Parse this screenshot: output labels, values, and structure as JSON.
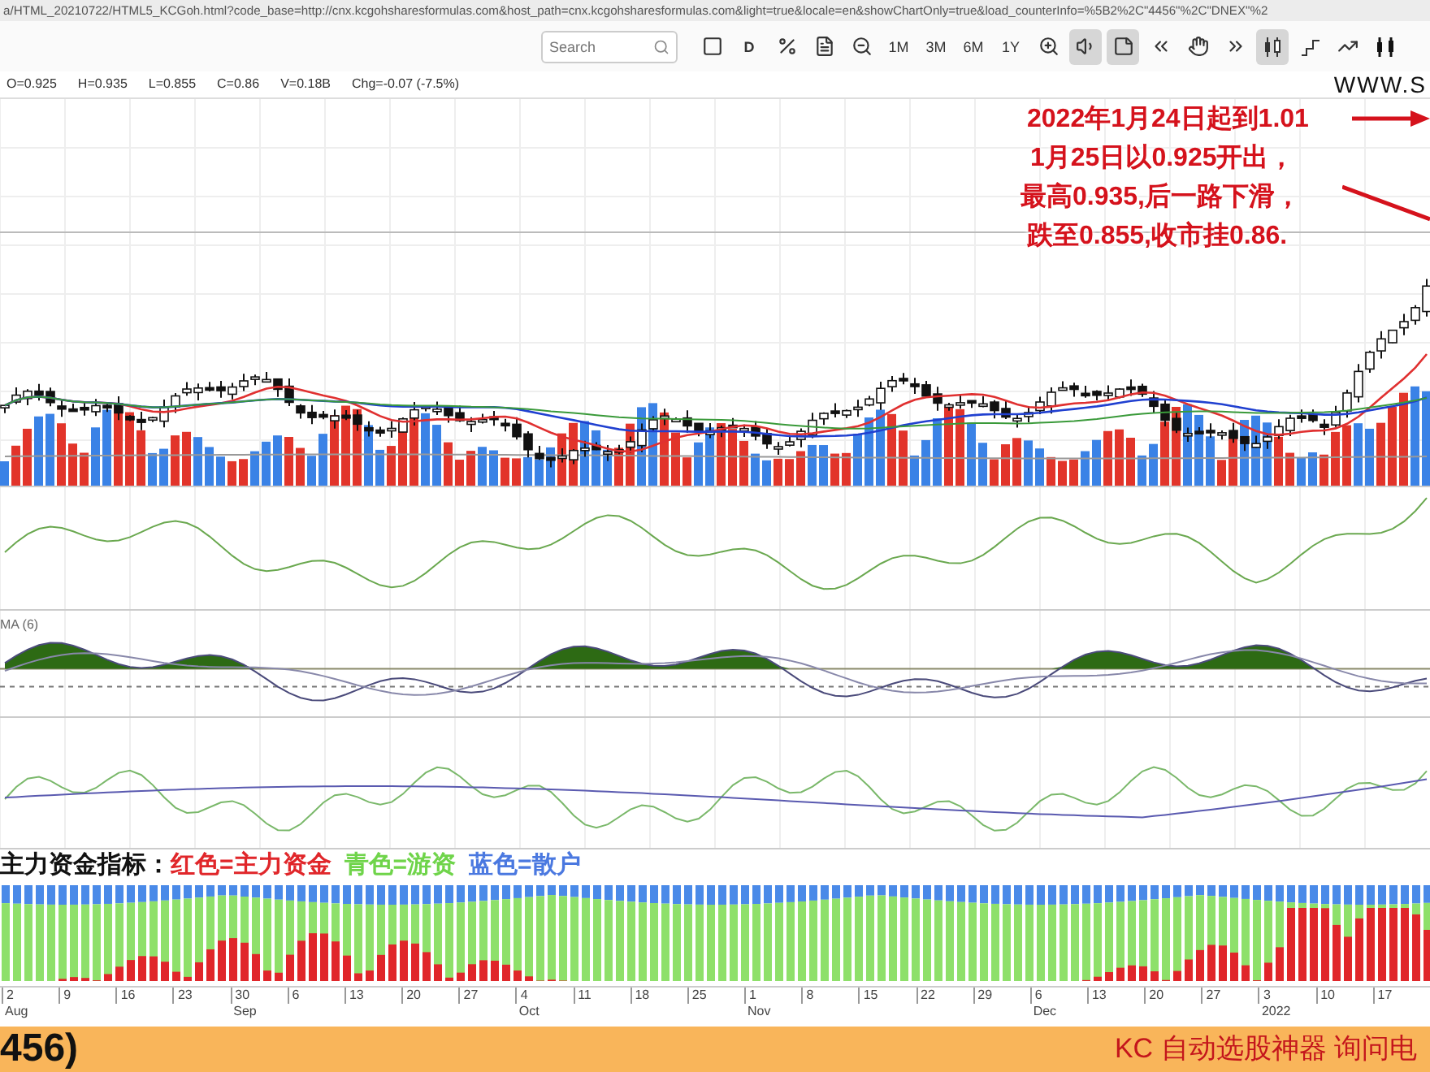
{
  "address_bar": {
    "url": "a/HTML_20210722/HTML5_KCGoh.html?code_base=http://cnx.kcgohsharesformulas.com&host_path=cnx.kcgohsharesformulas.com&light=true&locale=en&showChartOnly=true&load_counterInfo=%5B2%2C\"4456\"%2C\"DNEX\"%2"
  },
  "toolbar": {
    "search": {
      "placeholder": "Search"
    },
    "items": [
      {
        "kind": "icon",
        "selected": false
      },
      {
        "kind": "text",
        "label": "D",
        "selected": false
      },
      {
        "kind": "icon",
        "selected": false
      },
      {
        "kind": "icon",
        "selected": false
      },
      {
        "kind": "icon",
        "selected": false
      },
      {
        "kind": "text",
        "label": "1M",
        "selected": false
      },
      {
        "kind": "text",
        "label": "3M",
        "selected": false
      },
      {
        "kind": "text",
        "label": "6M",
        "selected": false
      },
      {
        "kind": "text",
        "label": "1Y",
        "selected": false
      },
      {
        "kind": "icon",
        "selected": false
      },
      {
        "kind": "icon",
        "selected": true
      },
      {
        "kind": "icon",
        "selected": true
      },
      {
        "kind": "icon",
        "selected": false
      },
      {
        "kind": "icon",
        "selected": false
      },
      {
        "kind": "icon",
        "selected": false
      },
      {
        "kind": "icon",
        "selected": true
      },
      {
        "kind": "icon",
        "selected": false
      },
      {
        "kind": "icon",
        "selected": false
      },
      {
        "kind": "icon",
        "selected": false
      }
    ]
  },
  "quote": {
    "values": [
      "O=0.925",
      "H=0.935",
      "L=0.855",
      "C=0.86",
      "V=0.18B",
      "Chg=-0.07 (-7.5%)"
    ],
    "site": "WWW.S"
  },
  "annotations": {
    "headline": "2022年1月24日起到1.01",
    "lines": [
      "1月25日以0.925开出，",
      "最高0.935,后一路下滑，",
      "跌至0.855,收市挂0.86."
    ]
  },
  "indicator_label": "MA (6)",
  "legend": [
    {
      "text": "主力资金指标：",
      "color": "#111111"
    },
    {
      "text": "红色=主力资金",
      "color": "#e0262a"
    },
    {
      "text": "青色=游资",
      "color": "#6fd44a"
    },
    {
      "text": "蓝色=散户",
      "color": "#4a78e0"
    }
  ],
  "x_axis": [
    {
      "day": "2",
      "month": "Aug"
    },
    {
      "day": "9"
    },
    {
      "day": "16"
    },
    {
      "day": "23"
    },
    {
      "day": "30",
      "month": "Sep"
    },
    {
      "day": "6"
    },
    {
      "day": "13"
    },
    {
      "day": "20"
    },
    {
      "day": "27"
    },
    {
      "day": "4",
      "month": "Oct"
    },
    {
      "day": "11"
    },
    {
      "day": "18"
    },
    {
      "day": "25"
    },
    {
      "day": "1",
      "month": "Nov"
    },
    {
      "day": "8"
    },
    {
      "day": "15"
    },
    {
      "day": "22"
    },
    {
      "day": "29"
    },
    {
      "day": "6",
      "month": "Dec"
    },
    {
      "day": "13"
    },
    {
      "day": "20"
    },
    {
      "day": "27"
    },
    {
      "day": "3",
      "month": "2022"
    },
    {
      "day": "10"
    },
    {
      "day": "17"
    }
  ],
  "footer": {
    "code": "456)",
    "slogan": "KC 自动选股神器 询问电"
  }
}
